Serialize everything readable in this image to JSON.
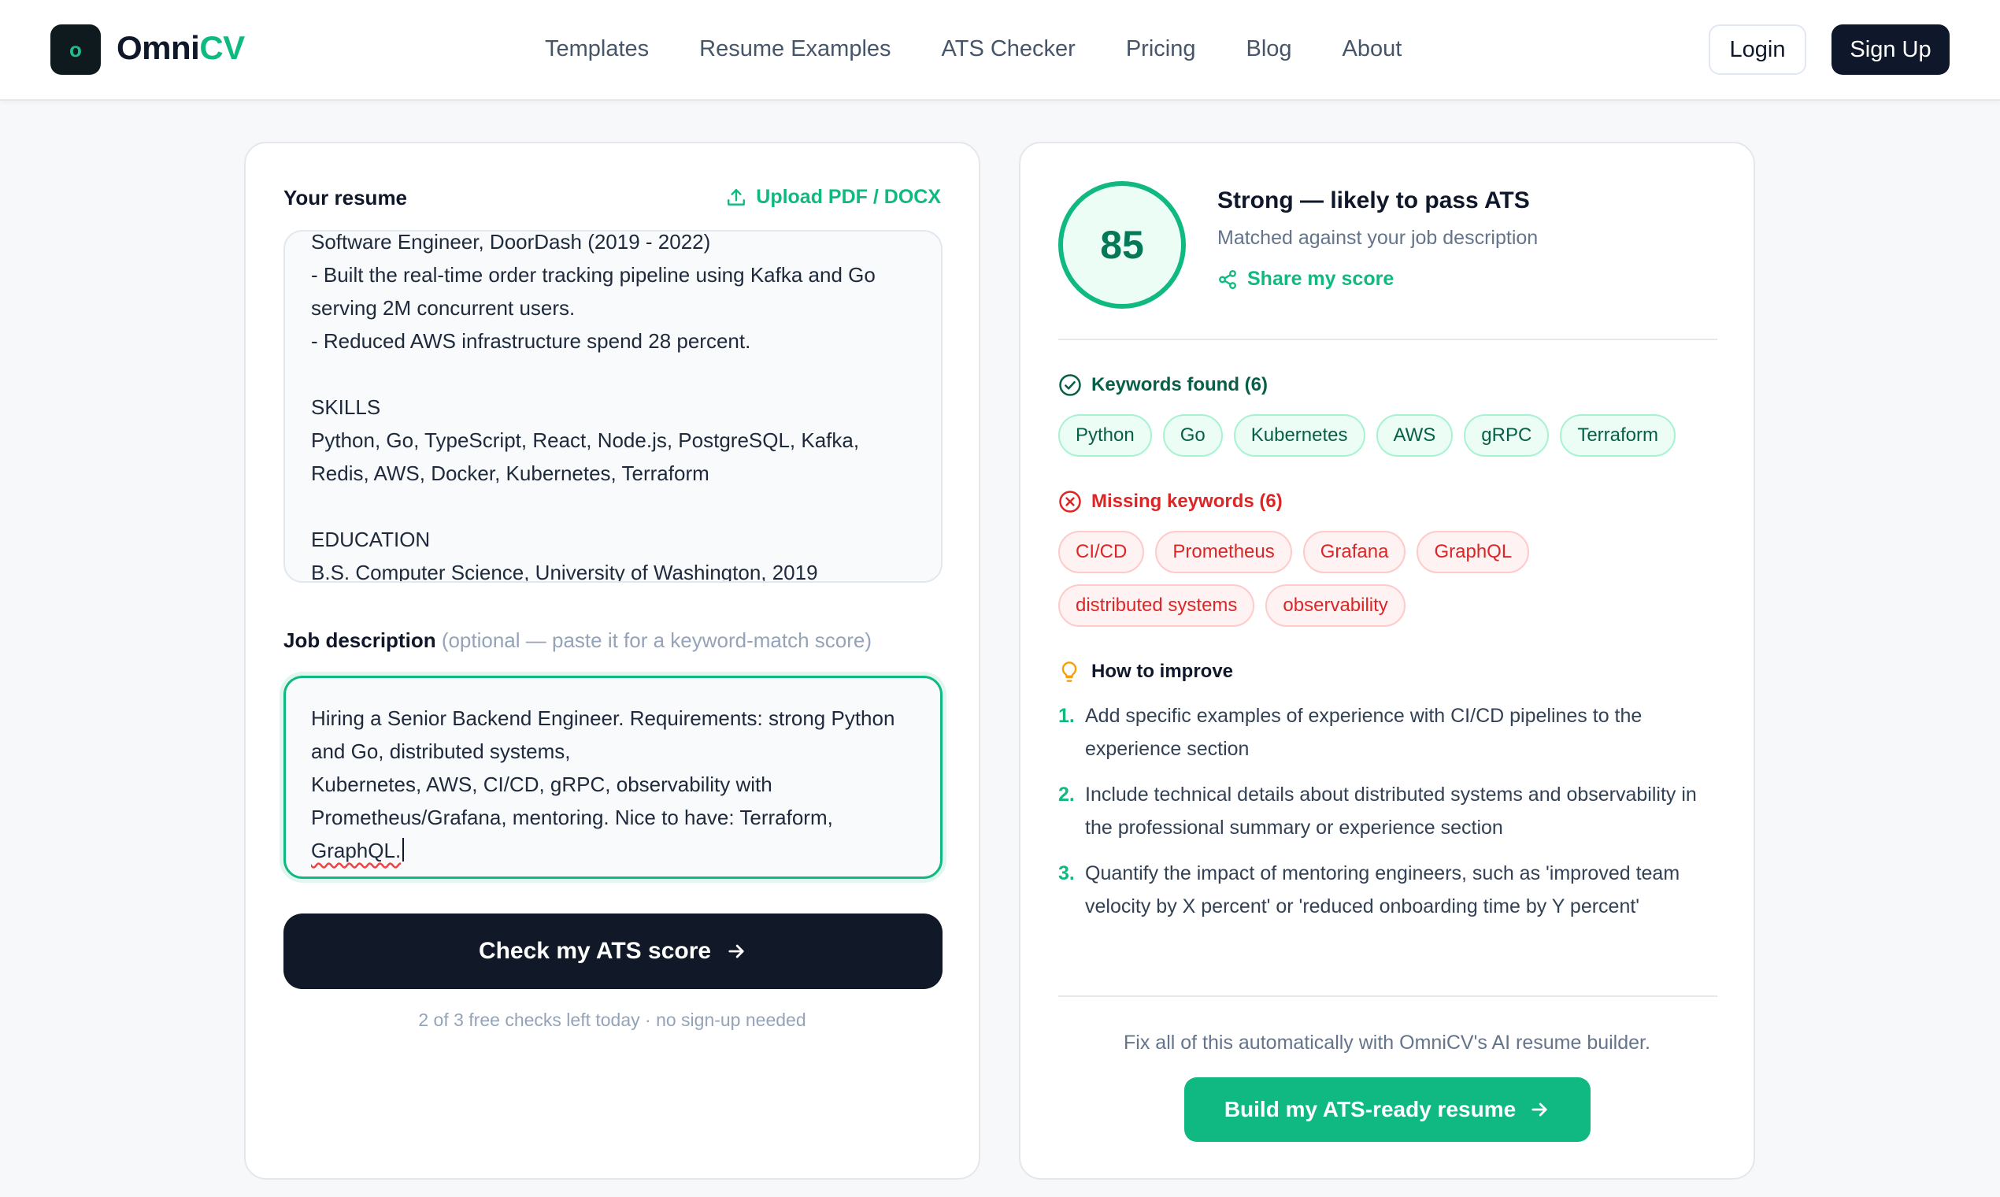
{
  "brand": {
    "logo_letter": "o",
    "name_part1": "Omni",
    "name_part2": "CV"
  },
  "nav": {
    "items": [
      "Templates",
      "Resume Examples",
      "ATS Checker",
      "Pricing",
      "Blog",
      "About"
    ],
    "login_label": "Login",
    "signup_label": "Sign Up"
  },
  "resume": {
    "label": "Your resume",
    "upload_label": "Upload PDF / DOCX",
    "lines": [
      "Software Engineer, DoorDash (2019 - 2022)",
      "- Built the real-time order tracking pipeline using Kafka and Go",
      "serving 2M concurrent users.",
      "- Reduced AWS infrastructure spend 28 percent.",
      "",
      "SKILLS",
      "Python, Go, TypeScript, React, Node.js, PostgreSQL, Kafka,",
      "Redis, AWS, Docker, Kubernetes, Terraform",
      "",
      "EDUCATION",
      "B.S. Computer Science, University of Washington, 2019"
    ]
  },
  "job_description": {
    "label": "Job description",
    "hint": "(optional — paste it for a keyword-match score)",
    "lines": [
      "Hiring a Senior Backend Engineer. Requirements: strong Python",
      "and Go, distributed systems,",
      "Kubernetes, AWS, CI/CD, gRPC, observability with",
      "Prometheus/Grafana, mentoring. Nice to have: Terraform,",
      "GraphQL."
    ]
  },
  "check_button_label": "Check my ATS score",
  "free_checks_note": "2 of 3 free checks left today · no sign-up needed",
  "score": {
    "value": "85",
    "title": "Strong — likely to pass ATS",
    "subtitle": "Matched against your job description",
    "share_label": "Share my score"
  },
  "keywords_found": {
    "heading": "Keywords found (6)",
    "items": [
      "Python",
      "Go",
      "Kubernetes",
      "AWS",
      "gRPC",
      "Terraform"
    ]
  },
  "keywords_missing": {
    "heading": "Missing keywords (6)",
    "items": [
      "CI/CD",
      "Prometheus",
      "Grafana",
      "GraphQL",
      "distributed systems",
      "observability"
    ]
  },
  "improve": {
    "heading": "How to improve",
    "tips": [
      {
        "num": "1.",
        "text": "Add specific examples of experience with CI/CD pipelines to the experience section"
      },
      {
        "num": "2.",
        "text": "Include technical details about distributed systems and observability in the professional summary or experience section"
      },
      {
        "num": "3.",
        "text": "Quantify the impact of mentoring engineers, such as 'improved team velocity by X percent' or 'reduced onboarding time by Y percent'"
      }
    ]
  },
  "cta": {
    "note": "Fix all of this automatically with OmniCV's AI resume builder.",
    "button_label": "Build my ATS-ready resume"
  },
  "colors": {
    "accent": "#10b981",
    "dark": "#0f172a",
    "missing": "#dc2626"
  }
}
